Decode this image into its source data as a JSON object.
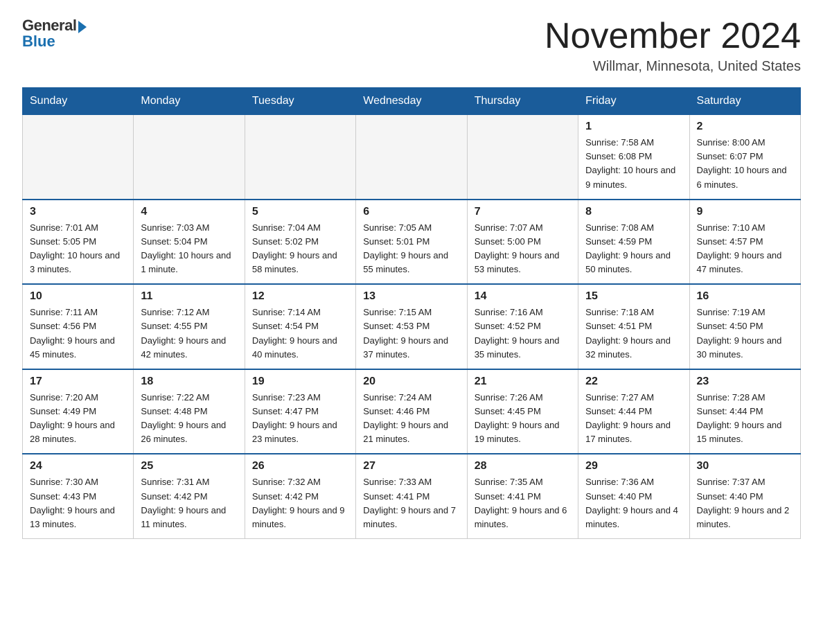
{
  "logo": {
    "line1": "General",
    "arrow": "▶",
    "line2": "Blue"
  },
  "title": {
    "month_year": "November 2024",
    "location": "Willmar, Minnesota, United States"
  },
  "days_of_week": [
    "Sunday",
    "Monday",
    "Tuesday",
    "Wednesday",
    "Thursday",
    "Friday",
    "Saturday"
  ],
  "weeks": [
    {
      "days": [
        {
          "num": "",
          "info": ""
        },
        {
          "num": "",
          "info": ""
        },
        {
          "num": "",
          "info": ""
        },
        {
          "num": "",
          "info": ""
        },
        {
          "num": "",
          "info": ""
        },
        {
          "num": "1",
          "info": "Sunrise: 7:58 AM\nSunset: 6:08 PM\nDaylight: 10 hours and 9 minutes."
        },
        {
          "num": "2",
          "info": "Sunrise: 8:00 AM\nSunset: 6:07 PM\nDaylight: 10 hours and 6 minutes."
        }
      ]
    },
    {
      "days": [
        {
          "num": "3",
          "info": "Sunrise: 7:01 AM\nSunset: 5:05 PM\nDaylight: 10 hours and 3 minutes."
        },
        {
          "num": "4",
          "info": "Sunrise: 7:03 AM\nSunset: 5:04 PM\nDaylight: 10 hours and 1 minute."
        },
        {
          "num": "5",
          "info": "Sunrise: 7:04 AM\nSunset: 5:02 PM\nDaylight: 9 hours and 58 minutes."
        },
        {
          "num": "6",
          "info": "Sunrise: 7:05 AM\nSunset: 5:01 PM\nDaylight: 9 hours and 55 minutes."
        },
        {
          "num": "7",
          "info": "Sunrise: 7:07 AM\nSunset: 5:00 PM\nDaylight: 9 hours and 53 minutes."
        },
        {
          "num": "8",
          "info": "Sunrise: 7:08 AM\nSunset: 4:59 PM\nDaylight: 9 hours and 50 minutes."
        },
        {
          "num": "9",
          "info": "Sunrise: 7:10 AM\nSunset: 4:57 PM\nDaylight: 9 hours and 47 minutes."
        }
      ]
    },
    {
      "days": [
        {
          "num": "10",
          "info": "Sunrise: 7:11 AM\nSunset: 4:56 PM\nDaylight: 9 hours and 45 minutes."
        },
        {
          "num": "11",
          "info": "Sunrise: 7:12 AM\nSunset: 4:55 PM\nDaylight: 9 hours and 42 minutes."
        },
        {
          "num": "12",
          "info": "Sunrise: 7:14 AM\nSunset: 4:54 PM\nDaylight: 9 hours and 40 minutes."
        },
        {
          "num": "13",
          "info": "Sunrise: 7:15 AM\nSunset: 4:53 PM\nDaylight: 9 hours and 37 minutes."
        },
        {
          "num": "14",
          "info": "Sunrise: 7:16 AM\nSunset: 4:52 PM\nDaylight: 9 hours and 35 minutes."
        },
        {
          "num": "15",
          "info": "Sunrise: 7:18 AM\nSunset: 4:51 PM\nDaylight: 9 hours and 32 minutes."
        },
        {
          "num": "16",
          "info": "Sunrise: 7:19 AM\nSunset: 4:50 PM\nDaylight: 9 hours and 30 minutes."
        }
      ]
    },
    {
      "days": [
        {
          "num": "17",
          "info": "Sunrise: 7:20 AM\nSunset: 4:49 PM\nDaylight: 9 hours and 28 minutes."
        },
        {
          "num": "18",
          "info": "Sunrise: 7:22 AM\nSunset: 4:48 PM\nDaylight: 9 hours and 26 minutes."
        },
        {
          "num": "19",
          "info": "Sunrise: 7:23 AM\nSunset: 4:47 PM\nDaylight: 9 hours and 23 minutes."
        },
        {
          "num": "20",
          "info": "Sunrise: 7:24 AM\nSunset: 4:46 PM\nDaylight: 9 hours and 21 minutes."
        },
        {
          "num": "21",
          "info": "Sunrise: 7:26 AM\nSunset: 4:45 PM\nDaylight: 9 hours and 19 minutes."
        },
        {
          "num": "22",
          "info": "Sunrise: 7:27 AM\nSunset: 4:44 PM\nDaylight: 9 hours and 17 minutes."
        },
        {
          "num": "23",
          "info": "Sunrise: 7:28 AM\nSunset: 4:44 PM\nDaylight: 9 hours and 15 minutes."
        }
      ]
    },
    {
      "days": [
        {
          "num": "24",
          "info": "Sunrise: 7:30 AM\nSunset: 4:43 PM\nDaylight: 9 hours and 13 minutes."
        },
        {
          "num": "25",
          "info": "Sunrise: 7:31 AM\nSunset: 4:42 PM\nDaylight: 9 hours and 11 minutes."
        },
        {
          "num": "26",
          "info": "Sunrise: 7:32 AM\nSunset: 4:42 PM\nDaylight: 9 hours and 9 minutes."
        },
        {
          "num": "27",
          "info": "Sunrise: 7:33 AM\nSunset: 4:41 PM\nDaylight: 9 hours and 7 minutes."
        },
        {
          "num": "28",
          "info": "Sunrise: 7:35 AM\nSunset: 4:41 PM\nDaylight: 9 hours and 6 minutes."
        },
        {
          "num": "29",
          "info": "Sunrise: 7:36 AM\nSunset: 4:40 PM\nDaylight: 9 hours and 4 minutes."
        },
        {
          "num": "30",
          "info": "Sunrise: 7:37 AM\nSunset: 4:40 PM\nDaylight: 9 hours and 2 minutes."
        }
      ]
    }
  ]
}
